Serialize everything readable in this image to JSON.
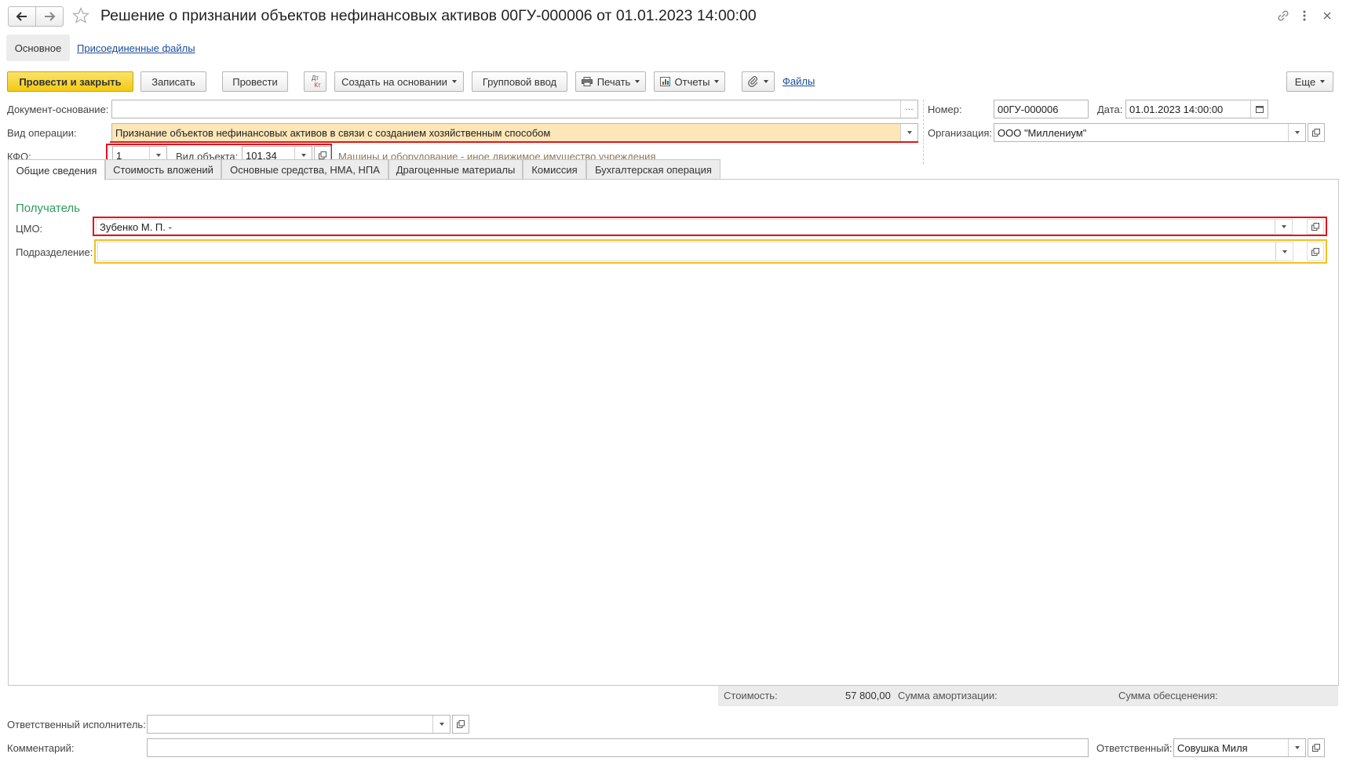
{
  "header": {
    "title": "Решение о признании объектов нефинансовых активов 00ГУ-000006 от 01.01.2023 14:00:00"
  },
  "sections": {
    "main": "Основное",
    "files": "Присоединенные файлы"
  },
  "toolbar": {
    "post_close": "Провести и закрыть",
    "save": "Записать",
    "post": "Провести",
    "dtkt_top": "Дт",
    "dtkt_bottom": "Кт",
    "create_based": "Создать на основании",
    "group_input": "Групповой ввод",
    "print": "Печать",
    "reports": "Отчеты",
    "files_link": "Файлы",
    "more": "Еще"
  },
  "form": {
    "doc_base_label": "Документ-основание:",
    "doc_base_value": "",
    "op_type_label": "Вид операции:",
    "op_type_value": "Признание объектов нефинансовых активов в связи с созданием хозяйственным способом",
    "kfo_label": "КФО:",
    "kfo_value": "1",
    "obj_type_label": "Вид объекта:",
    "obj_type_value": "101.34",
    "obj_hint": "Машины и оборудование - иное движимое имущество учреждения",
    "number_label": "Номер:",
    "number_value": "00ГУ-000006",
    "date_label": "Дата:",
    "date_value": "01.01.2023 14:00:00",
    "org_label": "Организация:",
    "org_value": "ООО \"Миллениум\""
  },
  "tabs": [
    "Общие сведения",
    "Стоимость вложений",
    "Основные средства, НМА, НПА",
    "Драгоценные материалы",
    "Комиссия",
    "Бухгалтерская операция"
  ],
  "recipient": {
    "title": "Получатель",
    "cmo_label": "ЦМО:",
    "cmo_value": "Зубенко М. П. -",
    "dept_label": "Подразделение:",
    "dept_value": ""
  },
  "summary": {
    "cost_label": "Стоимость:",
    "cost_value": "57 800,00",
    "amort_label": "Сумма амортизации:",
    "amort_value": "",
    "impair_label": "Сумма обесценения:",
    "impair_value": ""
  },
  "footer": {
    "executor_label": "Ответственный исполнитель:",
    "executor_value": "",
    "comment_label": "Комментарий:",
    "comment_value": "",
    "responsible_label": "Ответственный:",
    "responsible_value": "Совушка Миля"
  },
  "colors": {
    "primary_button": "#f3c912",
    "highlight_field": "#fde6b8",
    "red_frame": "#e3131b",
    "required_border": "#f0c020",
    "green_title": "#2c9c5c",
    "link": "#1a4d9c"
  }
}
